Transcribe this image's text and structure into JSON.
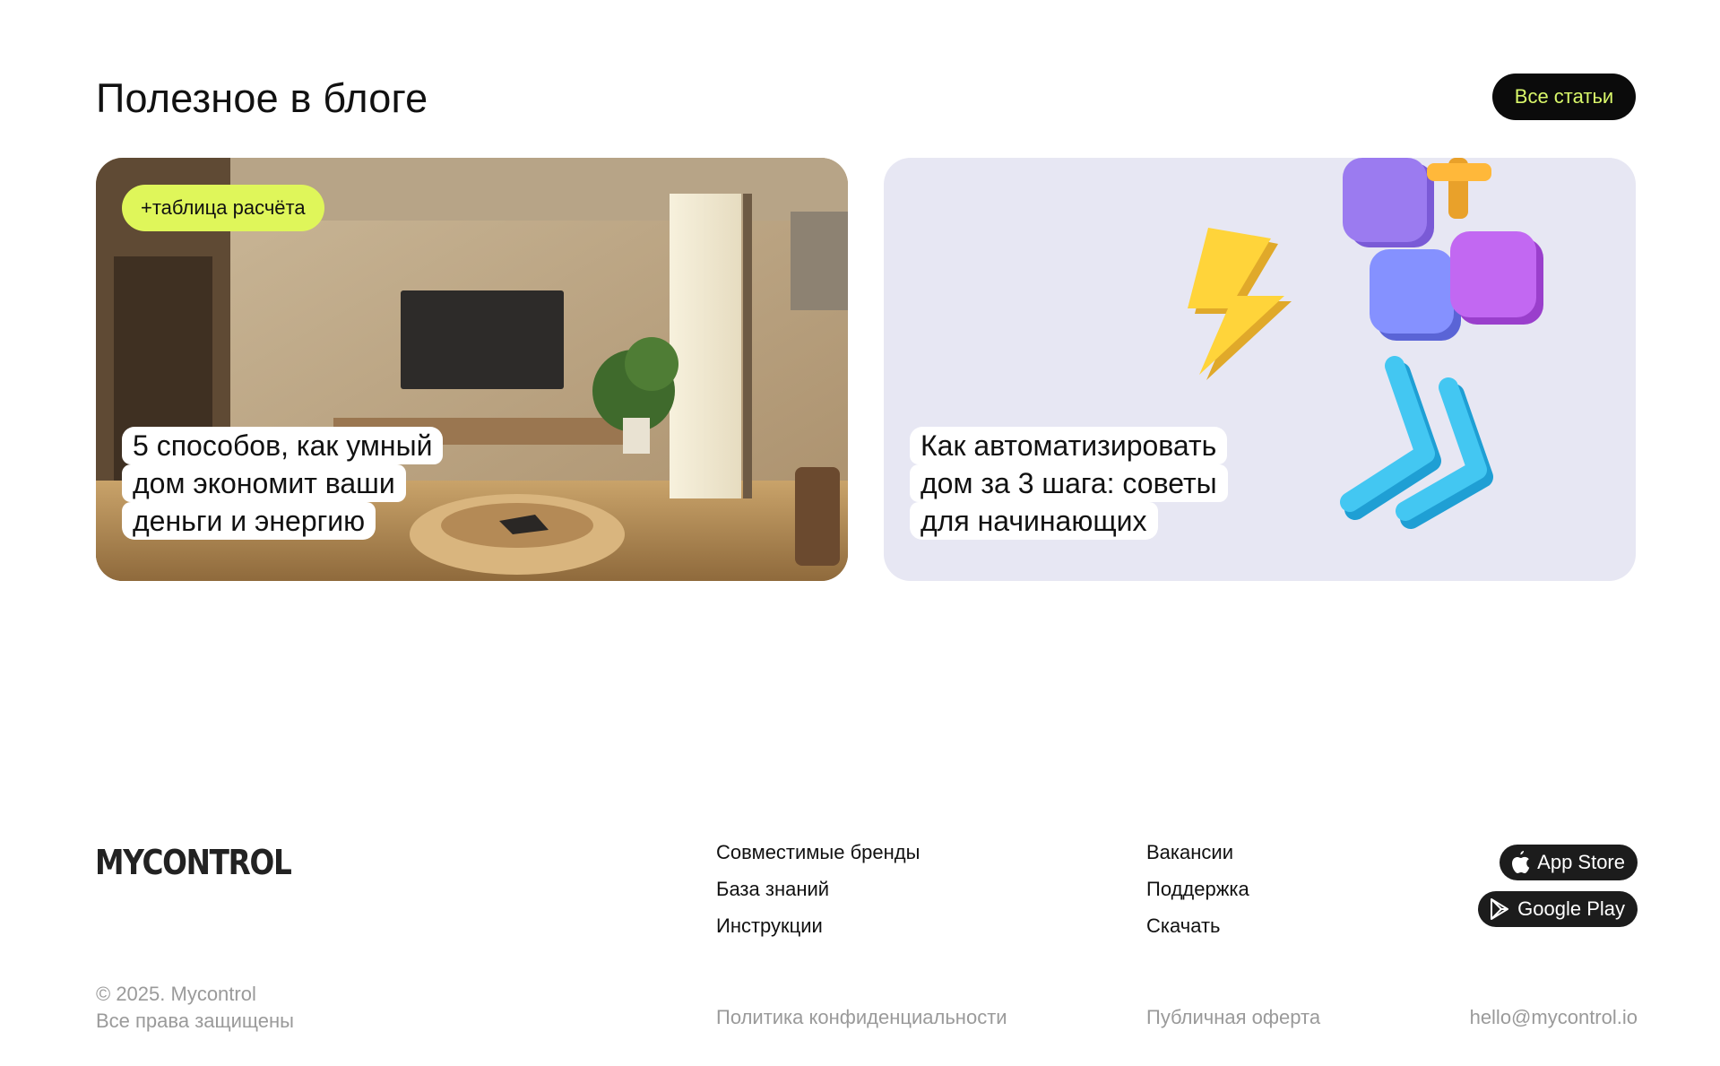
{
  "blog": {
    "title": "Полезное в блоге",
    "all_button": "Все статьи"
  },
  "cards": [
    {
      "tag": "+таблица расчёта",
      "title_lines": [
        "5 способов, как умный",
        "дом экономит ваши",
        "деньги и энергию"
      ]
    },
    {
      "title_lines": [
        "Как автоматизировать",
        "дом за 3 шага: советы",
        "для начинающих"
      ]
    }
  ],
  "footer": {
    "logo": "MYCONTROL",
    "col1": [
      "Совместимые бренды",
      "База знаний",
      "Инструкции"
    ],
    "col2": [
      "Вакансии",
      "Поддержка",
      "Скачать"
    ],
    "app_store": "App Store",
    "google_play": "Google Play",
    "copyright": "© 2025. Mycontrol",
    "rights": "Все права защищены",
    "privacy": "Политика конфиденциальности",
    "offer": "Публичная оферта",
    "email": "hello@mycontrol.io"
  },
  "colors": {
    "accent_lime": "#dff65a",
    "button_text_lime": "#d9f76a",
    "card2_bg": "#e7e7f3"
  }
}
